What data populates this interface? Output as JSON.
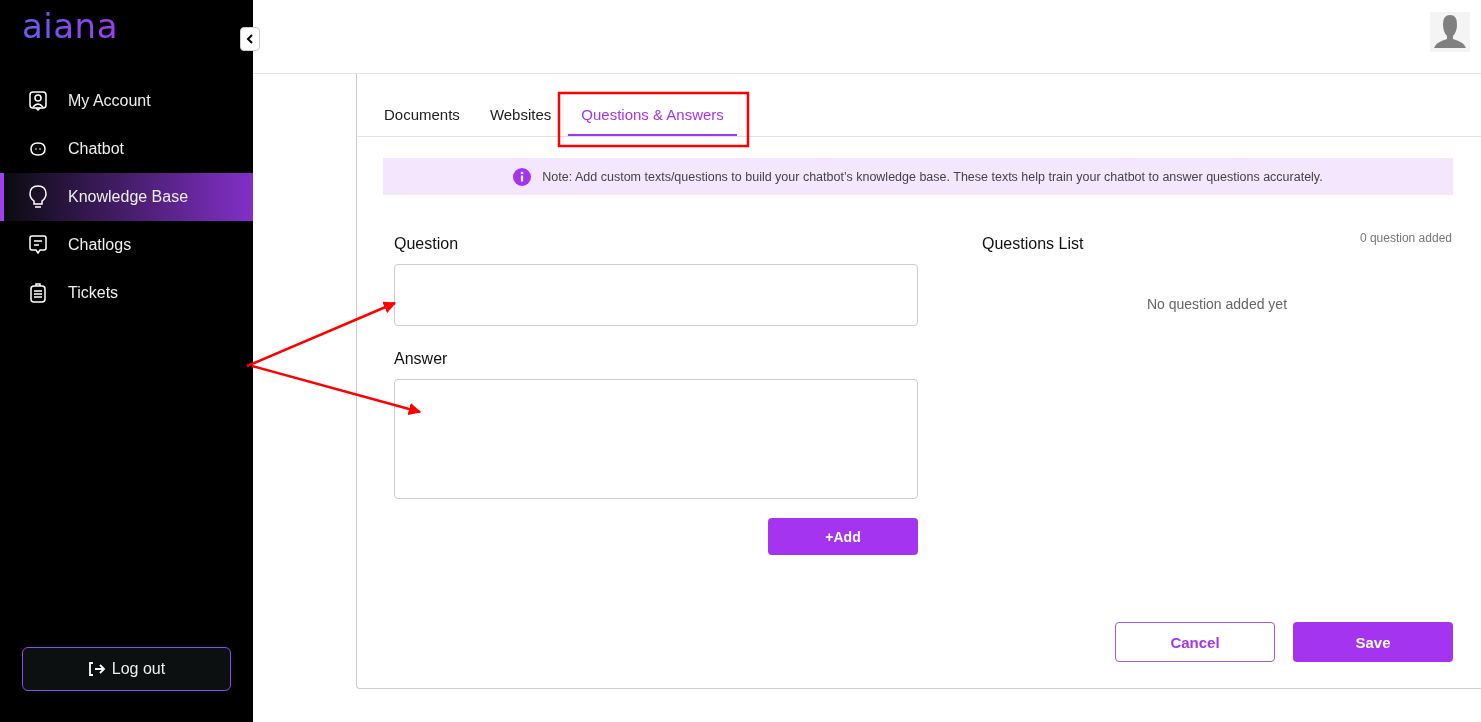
{
  "sidebar": {
    "logo": "aiana",
    "items": [
      {
        "label": "My Account",
        "selected": false
      },
      {
        "label": "Chatbot",
        "selected": false
      },
      {
        "label": "Knowledge Base",
        "selected": true
      },
      {
        "label": "Chatlogs",
        "selected": false
      },
      {
        "label": "Tickets",
        "selected": false
      }
    ],
    "logout": "Log out"
  },
  "tabs": [
    {
      "label": "Documents",
      "selected": false
    },
    {
      "label": "Websites",
      "selected": false
    },
    {
      "label": "Questions & Answers",
      "selected": true
    }
  ],
  "note": "Note: Add custom texts/questions to build your chatbot’s knowledge base. These texts help train your chatbot to answer questions accurately.",
  "form": {
    "question_label": "Question",
    "answer_label": "Answer",
    "add_button": "+Add"
  },
  "questions_list": {
    "title": "Questions List",
    "count": "0 question added",
    "empty": "No question added yet"
  },
  "buttons": {
    "cancel": "Cancel",
    "save": "Save"
  }
}
